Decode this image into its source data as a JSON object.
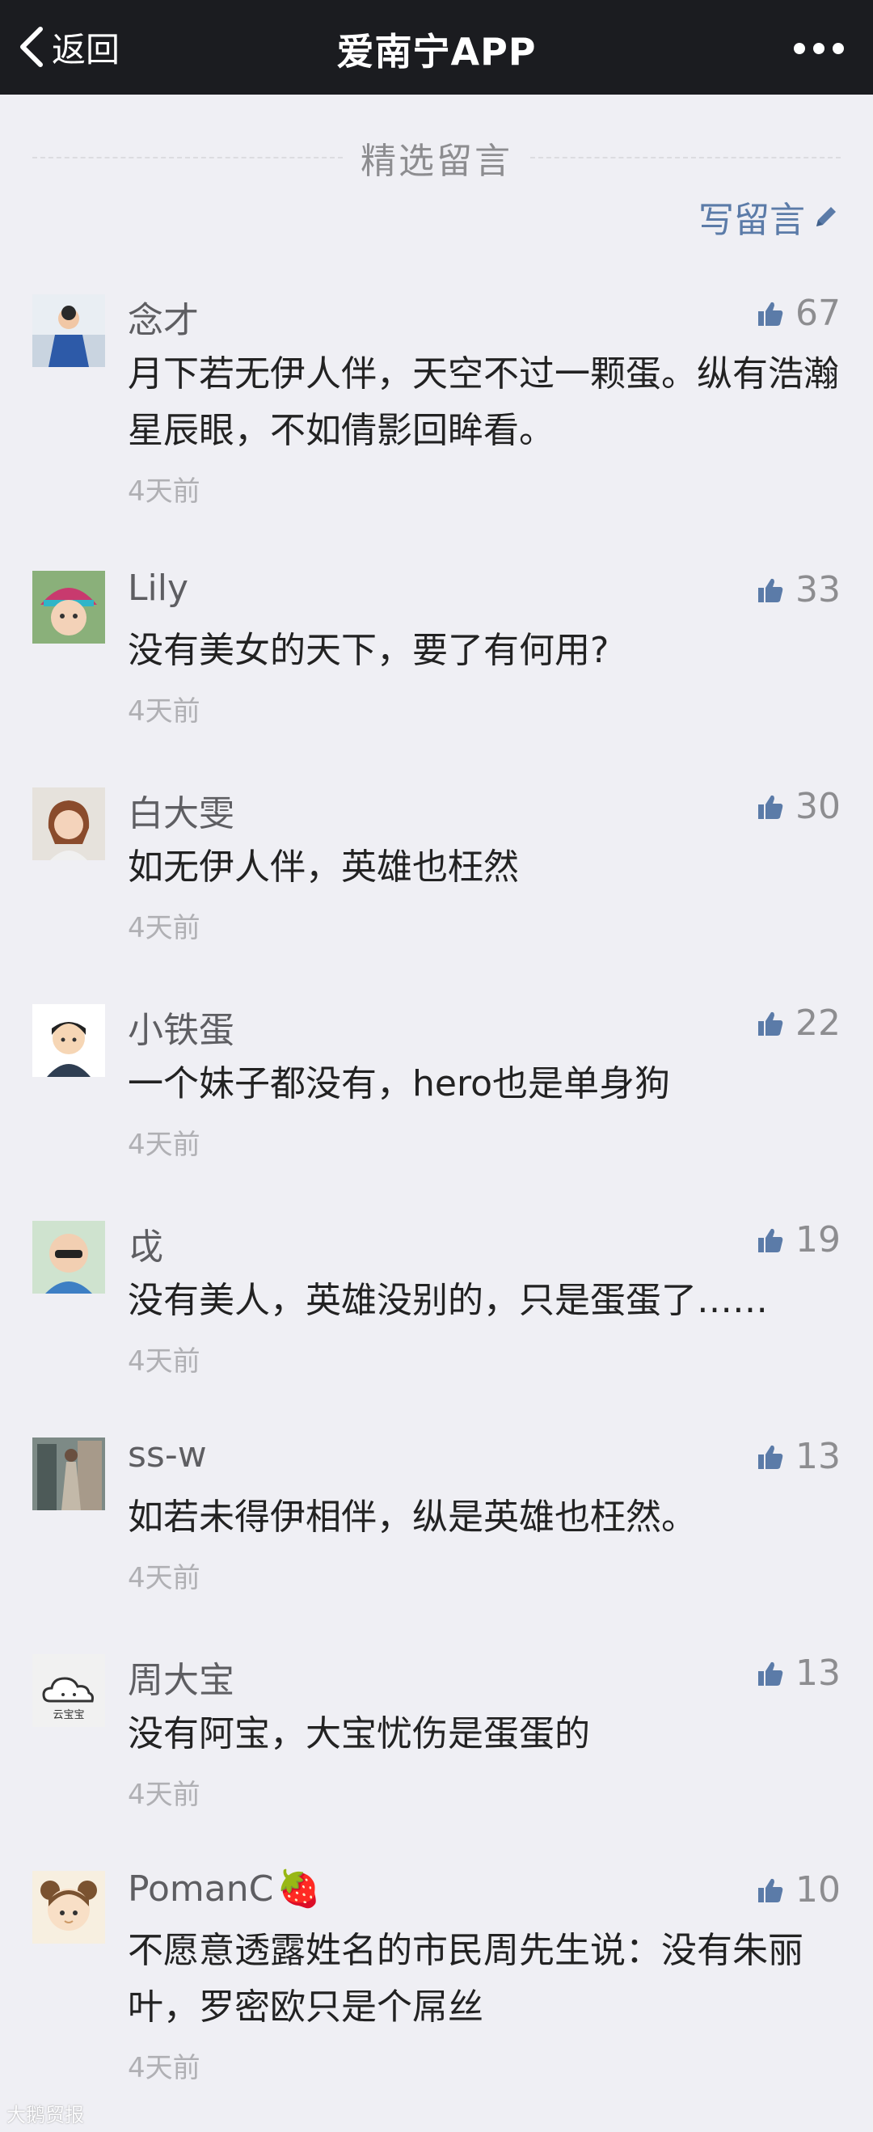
{
  "header": {
    "back_label": "返回",
    "title": "爱南宁APP"
  },
  "section": {
    "title": "精选留言",
    "write_label": "写留言"
  },
  "comments": [
    {
      "name": "念才",
      "likes": "67",
      "text": "月下若无伊人伴，天空不过一颗蛋。纵有浩瀚星辰眼，不如倩影回眸看。",
      "time": "4天前",
      "avatar_icon": "avatar-photo-person"
    },
    {
      "name": "Lily",
      "likes": "33",
      "text": "没有美女的天下，要了有何用?",
      "time": "4天前",
      "avatar_icon": "avatar-photo-child-hat"
    },
    {
      "name": "白大雯",
      "likes": "30",
      "text": "如无伊人伴，英雄也枉然",
      "time": "4天前",
      "avatar_icon": "avatar-photo-woman"
    },
    {
      "name": "小铁蛋",
      "likes": "22",
      "text": "一个妹子都没有，hero也是单身狗",
      "time": "4天前",
      "avatar_icon": "avatar-cartoon-boy"
    },
    {
      "name": "戉",
      "likes": "19",
      "text": "没有美人，英雄没别的，只是蛋蛋了……",
      "time": "4天前",
      "avatar_icon": "avatar-photo-baby"
    },
    {
      "name": "ss-w",
      "likes": "13",
      "text": "如若未得伊相伴，纵是英雄也枉然。",
      "time": "4天前",
      "avatar_icon": "avatar-photo-street"
    },
    {
      "name": "周大宝",
      "likes": "13",
      "text": "没有阿宝，大宝忧伤是蛋蛋的",
      "time": "4天前",
      "avatar_icon": "avatar-cloud-logo",
      "avatar_label": "云宝宝"
    },
    {
      "name": "PomanC",
      "name_emoji": "🍓",
      "likes": "10",
      "text": "不愿意透露姓名的市民周先生说：没有朱丽叶，罗密欧只是个屌丝",
      "time": "4天前",
      "avatar_icon": "avatar-cartoon-girl"
    }
  ],
  "watermark": "大鹅贸报",
  "colors": {
    "topbar": "#1b1c20",
    "background": "#efeff4",
    "link": "#5b7ba8",
    "like_icon": "#5b7ba8"
  }
}
